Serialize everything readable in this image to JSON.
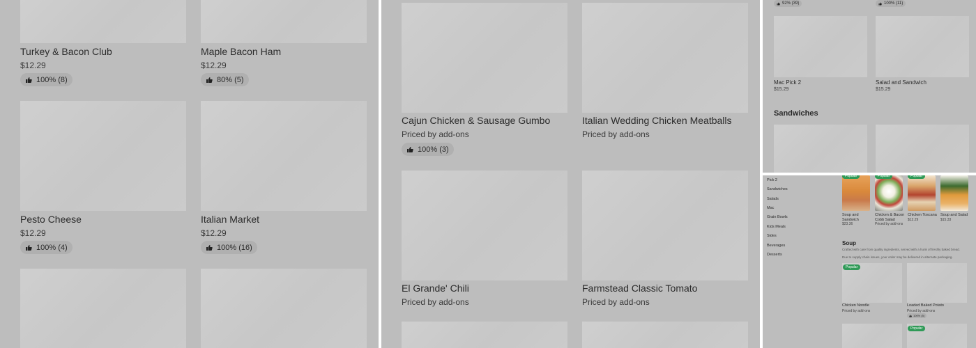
{
  "panel_a": {
    "items": [
      {
        "title": "Turkey & Bacon Club",
        "price": "$12.29",
        "rating": "100% (8)"
      },
      {
        "title": "Maple Bacon Ham",
        "price": "$12.29",
        "rating": "80% (5)"
      },
      {
        "title": "Pesto Cheese",
        "price": "$12.29",
        "rating": "100% (4)"
      },
      {
        "title": "Italian Market",
        "price": "$12.29",
        "rating": "100% (16)"
      }
    ]
  },
  "panel_b": {
    "items": [
      {
        "title": "Cajun Chicken & Sausage Gumbo",
        "price": "Priced by add-ons",
        "rating": "100% (3)"
      },
      {
        "title": "Italian Wedding Chicken Meatballs",
        "price": "Priced by add-ons"
      },
      {
        "title": "El Grande' Chili",
        "price": "Priced by add-ons"
      },
      {
        "title": "Farmstead Classic Tomato",
        "price": "Priced by add-ons"
      }
    ]
  },
  "panel_c": {
    "top_ratings": [
      "92% (39)",
      "100% (11)"
    ],
    "items": [
      {
        "title": "Mac Pick 2",
        "price": "$15.29"
      },
      {
        "title": "Salad and Sandwich",
        "price": "$15.29"
      }
    ],
    "section_heading": "Sandwiches"
  },
  "panel_d": {
    "nav": [
      "Pick 2",
      "Sandwiches",
      "Salads",
      "Mac",
      "Grain Bowls",
      "Kids Meals",
      "Sides",
      "Beverages",
      "Desserts"
    ],
    "featured": [
      {
        "title": "Soup and Sandwich",
        "price": "$23.36"
      },
      {
        "title": "Chicken & Bacon Cobb Salad",
        "price": "Priced by add-ons"
      },
      {
        "title": "Chicken Toscana",
        "price": "$12.29"
      },
      {
        "title": "Soup and Salad",
        "price": "$15.33"
      }
    ],
    "soup_heading": "Soup",
    "soup_desc": "Crafted with care from quality ingredients, served with a hunk of freshly baked bread.",
    "soup_note": "Due to supply chain issues, your order may be delivered in alternate packaging.",
    "popular_label": "Popular",
    "soup_items": [
      {
        "title": "Chicken Noodle",
        "price": "Priced by add-ons"
      },
      {
        "title": "Loaded Baked Potato",
        "price": "Priced by add-ons",
        "rating": "100% (5)"
      }
    ]
  },
  "colors": {
    "popular": "#2f9a57",
    "panel_bg": "#bdbdbd",
    "placeholder": "#cbcbcb"
  },
  "icons": {
    "rating": "thumbs-up-icon"
  }
}
